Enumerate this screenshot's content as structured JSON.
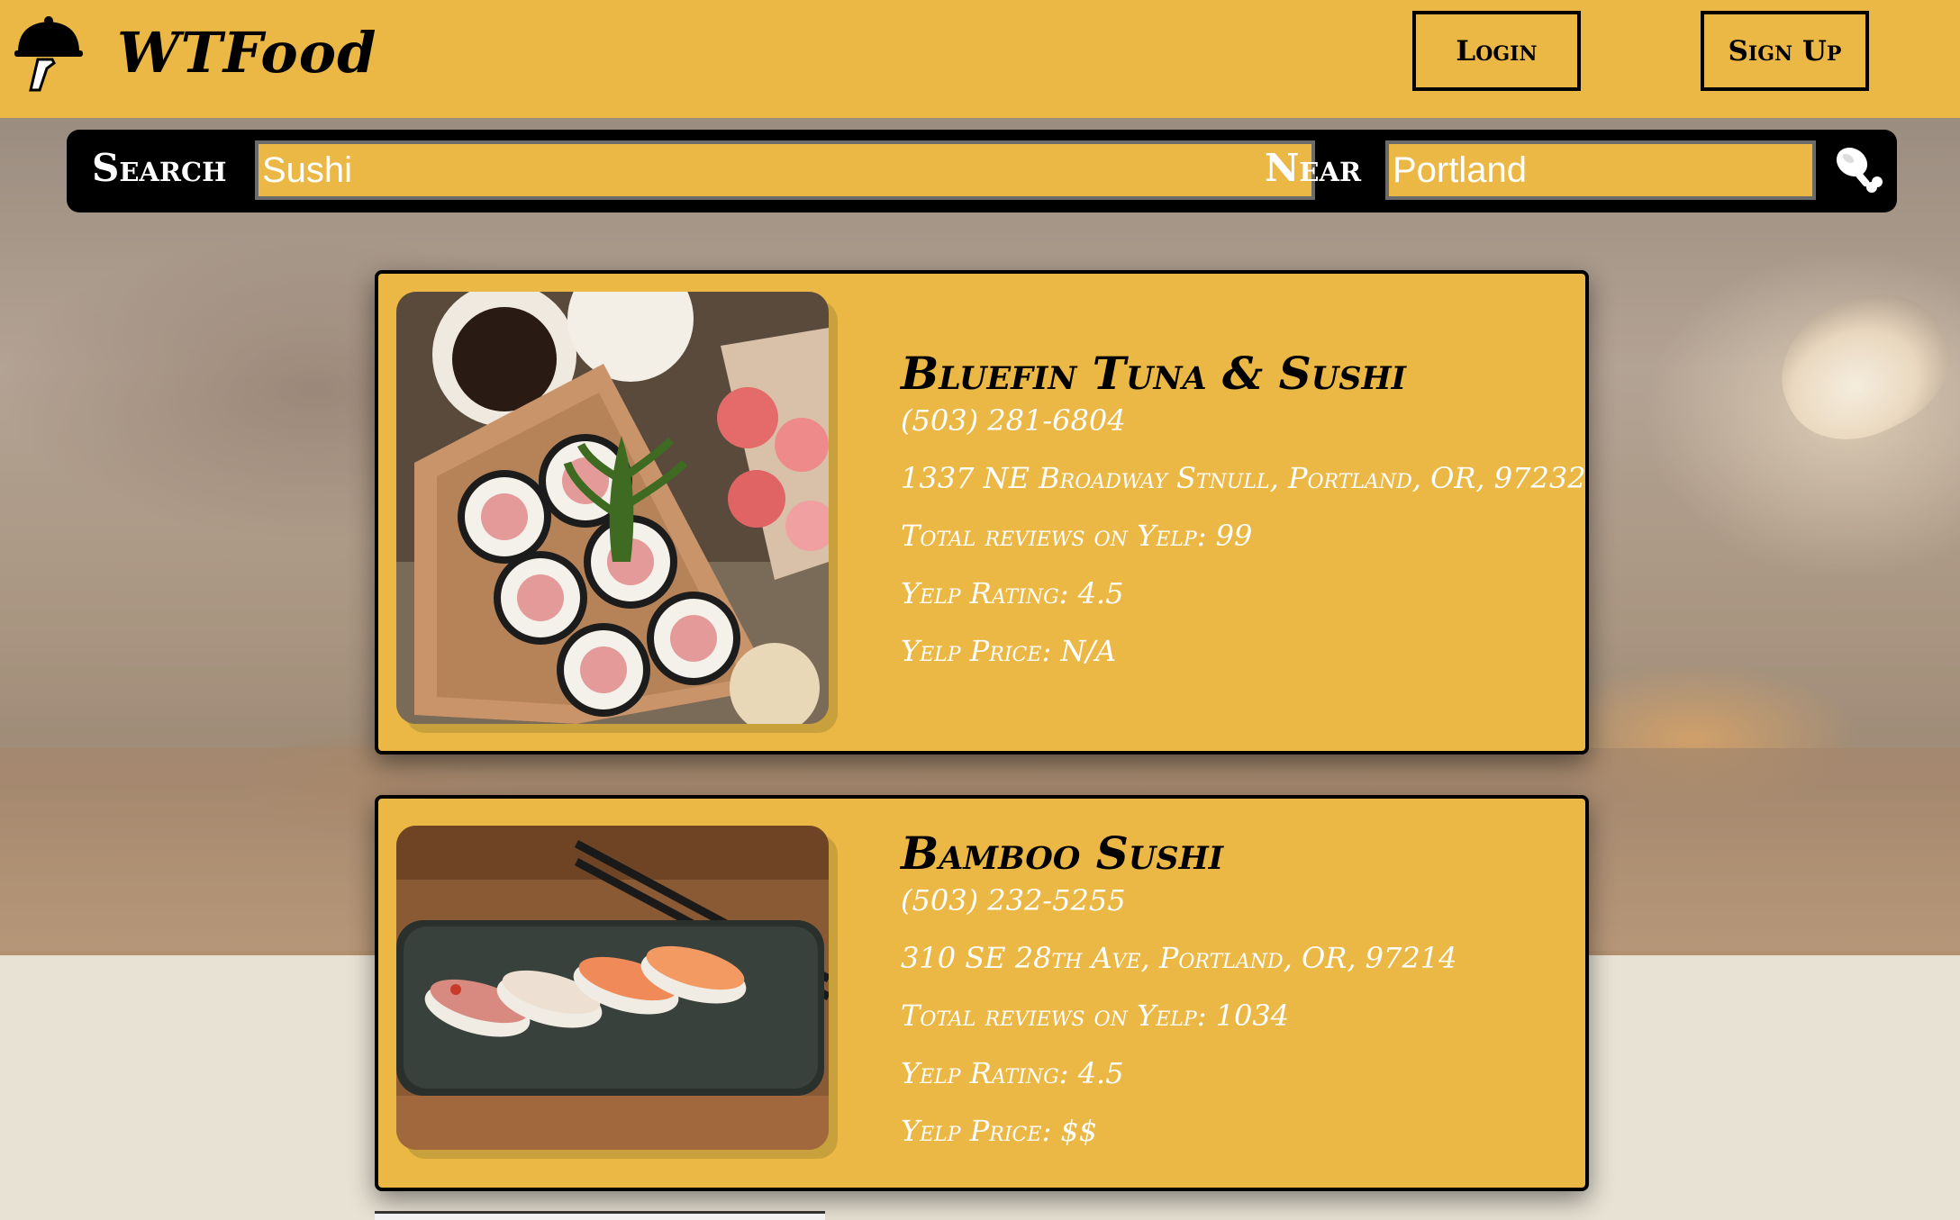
{
  "header": {
    "brand": "WTFood",
    "logo_icon": "cloche-in-hand-icon",
    "login_label": "Login",
    "signup_label": "Sign Up",
    "accent_color": "#ebb846"
  },
  "search": {
    "search_label": "Search",
    "query_value": "Sushi",
    "near_label": "Near",
    "location_value": "Portland",
    "submit_icon": "drumstick-icon"
  },
  "results": [
    {
      "name": "Bluefin Tuna & Sushi",
      "phone": "(503) 281-6804",
      "address": "1337 NE Broadway Stnull, Portland, OR, 97232",
      "reviews": "Total reviews on Yelp: 99",
      "rating": "Yelp Rating: 4.5",
      "price": "Yelp Price: N/A"
    },
    {
      "name": "Bamboo Sushi",
      "phone": "(503) 232-5255",
      "address": "310 SE 28th Ave, Portland, OR, 97214",
      "reviews": "Total reviews on Yelp: 1034",
      "rating": "Yelp Rating: 4.5",
      "price": "Yelp Price: $$"
    }
  ]
}
